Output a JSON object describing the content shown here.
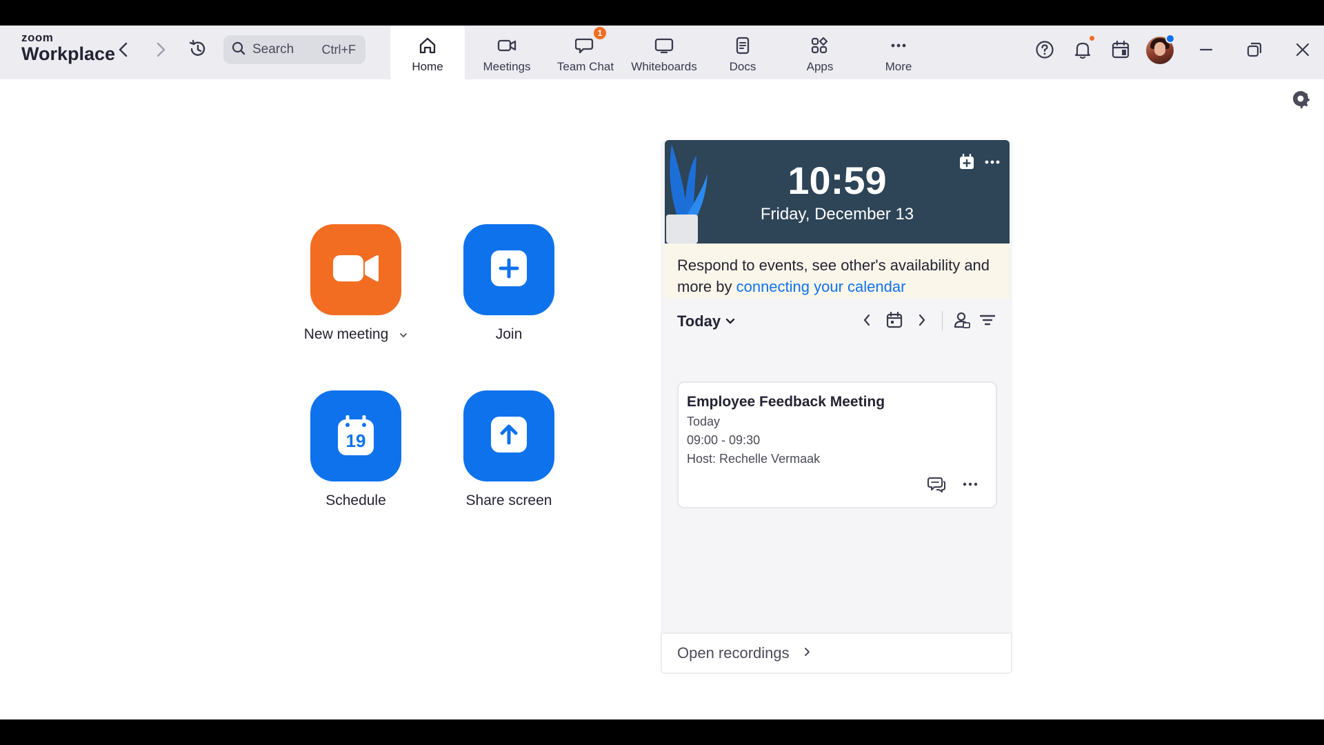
{
  "brand": {
    "line1": "zoom",
    "line2": "Workplace"
  },
  "search": {
    "placeholder": "Search",
    "shortcut": "Ctrl+F"
  },
  "nav": {
    "tabs": [
      {
        "label": "Home",
        "icon": "home-icon",
        "active": true
      },
      {
        "label": "Meetings",
        "icon": "video-icon"
      },
      {
        "label": "Team Chat",
        "icon": "chat-icon",
        "badge": "1"
      },
      {
        "label": "Whiteboards",
        "icon": "whiteboard-icon"
      },
      {
        "label": "Docs",
        "icon": "document-icon"
      },
      {
        "label": "Apps",
        "icon": "apps-icon"
      },
      {
        "label": "More",
        "icon": "more-dots-icon"
      }
    ]
  },
  "actions": [
    {
      "label": "New meeting",
      "icon": "video-camera-icon",
      "color": "#f26d21"
    },
    {
      "label": "Join",
      "icon": "plus-icon",
      "color": "#0e72ed"
    },
    {
      "label": "Schedule",
      "icon": "calendar-icon",
      "calendar_day": "19",
      "color": "#0e72ed"
    },
    {
      "label": "Share screen",
      "icon": "share-up-arrow-icon",
      "color": "#0e72ed"
    }
  ],
  "clock": {
    "time": "10:59",
    "date": "Friday, December 13"
  },
  "notice": {
    "text": "Respond to events, see other's availability and more by ",
    "link": "connecting your calendar"
  },
  "calendar": {
    "range_label": "Today"
  },
  "event": {
    "title": "Employee Feedback Meeting",
    "day": "Today",
    "time": "09:00 - 09:30",
    "host": "Host: Rechelle Vermaak"
  },
  "recordings": {
    "label": "Open recordings"
  },
  "colors": {
    "accent": "#0e72ed",
    "orange": "#f26d21",
    "hero": "#2e4457"
  }
}
